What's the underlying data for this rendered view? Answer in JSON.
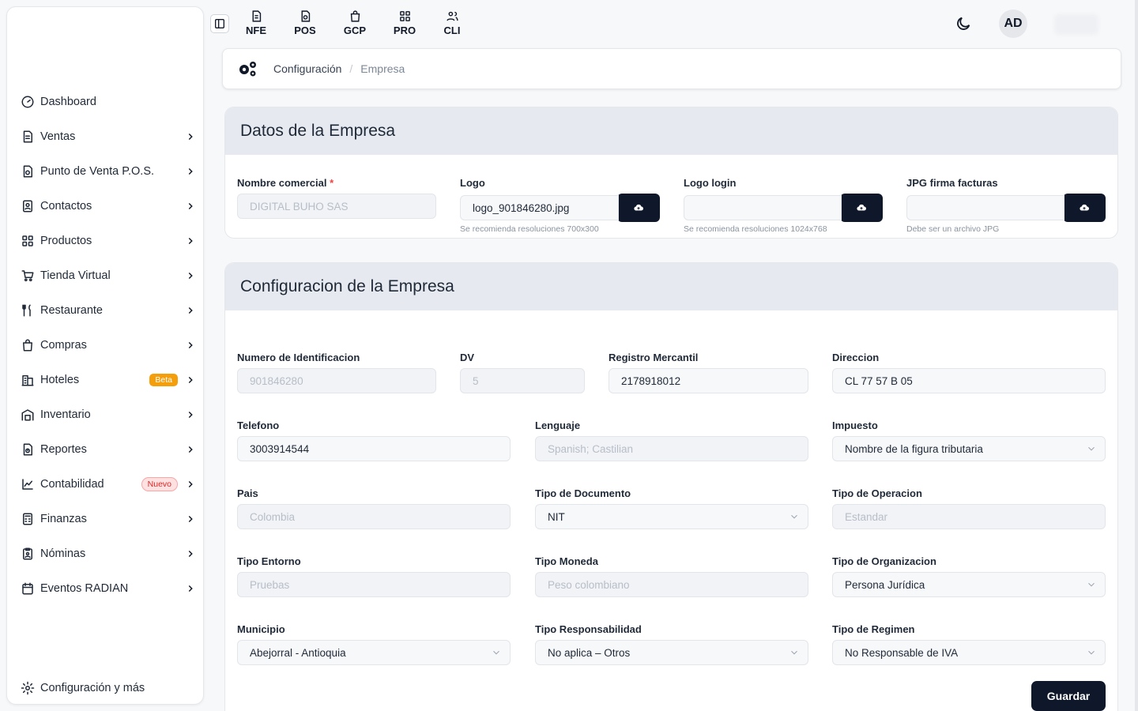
{
  "sidebar": {
    "items": [
      {
        "label": "Dashboard",
        "icon": "dashboard-gauge-icon"
      },
      {
        "label": "Ventas",
        "icon": "document-icon"
      },
      {
        "label": "Punto de Venta P.O.S.",
        "icon": "pos-icon"
      },
      {
        "label": "Contactos",
        "icon": "contacts-icon"
      },
      {
        "label": "Productos",
        "icon": "grid-icon"
      },
      {
        "label": "Tienda Virtual",
        "icon": "cart-icon"
      },
      {
        "label": "Restaurante",
        "icon": "utensils-icon"
      },
      {
        "label": "Compras",
        "icon": "shopping-bag-icon"
      },
      {
        "label": "Hoteles",
        "icon": "hotel-icon",
        "badge": "Beta"
      },
      {
        "label": "Inventario",
        "icon": "warehouse-icon"
      },
      {
        "label": "Reportes",
        "icon": "report-icon"
      },
      {
        "label": "Contabilidad",
        "icon": "chart-icon",
        "badge": "Nuevo"
      },
      {
        "label": "Finanzas",
        "icon": "calculator-icon"
      },
      {
        "label": "Nóminas",
        "icon": "payroll-icon"
      },
      {
        "label": "Eventos RADIAN",
        "icon": "calendar-icon"
      }
    ],
    "footer": "Configuración y más"
  },
  "topbar": {
    "modules": [
      "NFE",
      "POS",
      "GCP",
      "PRO",
      "CLI"
    ],
    "avatar": "AD"
  },
  "breadcrumb": {
    "section": "Configuración",
    "current": "Empresa"
  },
  "datos": {
    "title": "Datos de la Empresa",
    "nombre_label": "Nombre comercial",
    "nombre_req": "*",
    "nombre_value": "DIGITAL BUHO SAS",
    "logo_label": "Logo",
    "logo_value": "logo_901846280.jpg",
    "logo_hint": "Se recomienda resoluciones 700x300",
    "logologin_label": "Logo login",
    "logologin_value": "",
    "logologin_hint": "Se recomienda resoluciones 1024x768",
    "firma_label": "JPG firma facturas",
    "firma_value": "",
    "firma_hint": "Debe ser un archivo JPG"
  },
  "config": {
    "title": "Configuracion de la Empresa",
    "fields": {
      "nit": {
        "label": "Numero de Identificacion",
        "value": "901846280"
      },
      "dv": {
        "label": "DV",
        "value": "5"
      },
      "registro": {
        "label": "Registro Mercantil",
        "value": "2178918012"
      },
      "direccion": {
        "label": "Direccion",
        "value": "CL 77 57 B 05"
      },
      "telefono": {
        "label": "Telefono",
        "value": "3003914544"
      },
      "lenguaje": {
        "label": "Lenguaje",
        "value": "Spanish; Castilian"
      },
      "impuesto": {
        "label": "Impuesto",
        "value": "Nombre de la figura tributaria"
      },
      "pais": {
        "label": "Pais",
        "value": "Colombia"
      },
      "tipo_doc": {
        "label": "Tipo de Documento",
        "value": "NIT"
      },
      "tipo_op": {
        "label": "Tipo de Operacion",
        "value": "Estandar"
      },
      "entorno": {
        "label": "Tipo Entorno",
        "value": "Pruebas"
      },
      "moneda": {
        "label": "Tipo Moneda",
        "value": "Peso colombiano"
      },
      "organizacion": {
        "label": "Tipo de Organizacion",
        "value": "Persona Jurídica"
      },
      "municipio": {
        "label": "Municipio",
        "value": "Abejorral - Antioquia"
      },
      "responsabilidad": {
        "label": "Tipo Responsabilidad",
        "value": "No aplica – Otros"
      },
      "regimen": {
        "label": "Tipo de Regimen",
        "value": "No Responsable de IVA"
      }
    },
    "save_label": "Guardar"
  }
}
